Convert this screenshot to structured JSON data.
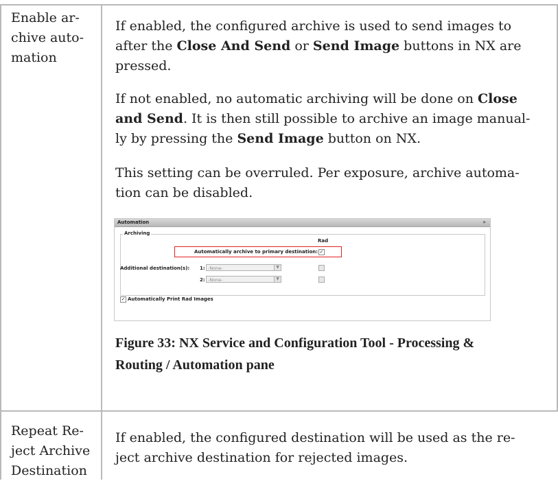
{
  "rows": [
    {
      "setting_lines": [
        "Enable ar-",
        "chive auto-",
        "mation"
      ],
      "paragraphs": [
        {
          "lines": [
            [
              {
                "t": "If enabled, the configured archive is used to send images to",
                "b": false
              }
            ],
            [
              {
                "t": "after the ",
                "b": false
              },
              {
                "t": "Close And Send",
                "b": true
              },
              {
                "t": " or ",
                "b": false
              },
              {
                "t": "Send Image",
                "b": true
              },
              {
                "t": " buttons in NX are",
                "b": false
              }
            ],
            [
              {
                "t": "pressed.",
                "b": false
              }
            ]
          ]
        },
        {
          "lines": [
            [
              {
                "t": "If not enabled, no automatic archiving will be done on ",
                "b": false
              },
              {
                "t": "Close",
                "b": true
              }
            ],
            [
              {
                "t": "and Send",
                "b": true
              },
              {
                "t": ". It is then still possible to archive an image manual-",
                "b": false
              }
            ],
            [
              {
                "t": "ly by pressing the ",
                "b": false
              },
              {
                "t": "Send Image",
                "b": true
              },
              {
                "t": " button on NX.",
                "b": false
              }
            ]
          ]
        },
        {
          "lines": [
            [
              {
                "t": "This setting can be overruled. Per exposure, archive automa-",
                "b": false
              }
            ],
            [
              {
                "t": "tion can be disabled.",
                "b": false
              }
            ]
          ]
        }
      ],
      "figure": {
        "pane_title": "Automation",
        "collapse_glyph": "»",
        "group_label": "Archiving",
        "column_header": "Rad",
        "auto_archive_label": "Automatically archive to primary destination:",
        "auto_archive_checked": true,
        "additional_label": "Additional destination(s):",
        "destinations": [
          {
            "num": "1:",
            "value": "-None-",
            "checked": false
          },
          {
            "num": "2:",
            "value": "-None-",
            "checked": false
          }
        ],
        "print_label": "Automatically Print Rad Images",
        "print_checked": true,
        "highlight_color": "#e02020"
      },
      "caption_lines": [
        "Figure 33: NX Service and Configuration Tool - Processing &",
        "Routing / Automation pane"
      ]
    },
    {
      "setting_lines": [
        "Repeat Re-",
        "ject Archive",
        "Destination"
      ],
      "paragraphs": [
        {
          "lines": [
            [
              {
                "t": "If enabled, the configured destination will be used as the re-",
                "b": false
              }
            ],
            [
              {
                "t": "ject archive destination for rejected images.",
                "b": false
              }
            ]
          ]
        }
      ]
    }
  ],
  "colors": {
    "rule": "#b9b9b9",
    "text": "#222222"
  }
}
